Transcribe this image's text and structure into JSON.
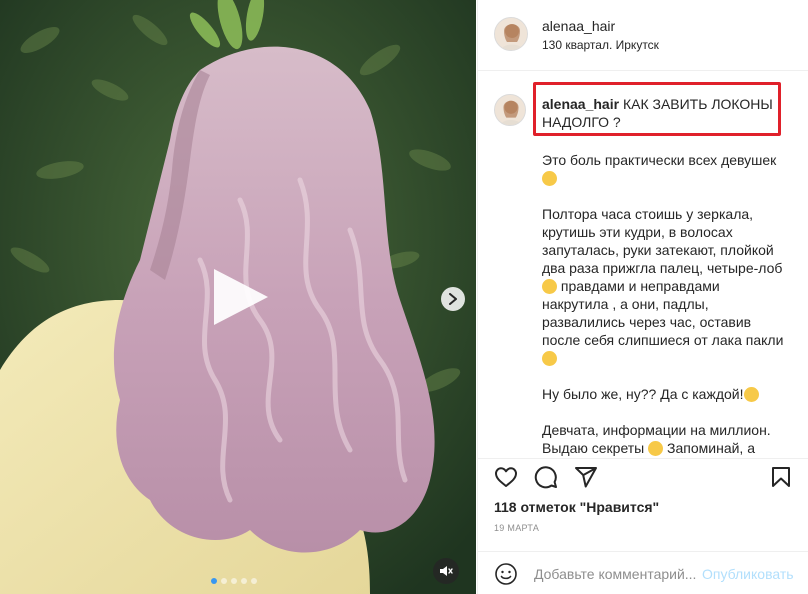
{
  "post": {
    "username": "alenaa_hair",
    "location": "130 квартал. Иркутск",
    "caption_title": "КАК ЗАВИТЬ ЛОКОНЫ НАДОЛГО ?",
    "caption_lines": [
      "Это боль практически всех девушек",
      "",
      "Полтора часа стоишь у зеркала,",
      "крутишь эти кудри, в волосах",
      "запуталась, руки затекают, плойкой",
      "два раза прижгла палец, четыре-лоб",
      "правдами и неправдами",
      "накрутила , а они, падлы,",
      "развалились через час, оставив",
      "после себя слипшиеся от лака пакли",
      "",
      "Ну было же, ну?? Да с каждой!",
      "",
      "Девчата, информации на миллион.",
      "Выдаю секреты  Запоминай, а"
    ],
    "likes": "118 отметок \"Нравится\"",
    "date": "19 МАРТА",
    "comment_placeholder": "Добавьте комментарий...",
    "publish_label": "Опубликовать"
  },
  "media": {
    "carousel_count": 5,
    "active_index": 0
  },
  "icons": {
    "like": "heart-icon",
    "comment": "comment-icon",
    "share": "share-icon",
    "save": "bookmark-icon",
    "emoji": "smiley-icon",
    "play": "play-icon",
    "next": "chevron-right-icon",
    "mute": "speaker-muted-icon"
  },
  "colors": {
    "highlight": "#e0202a",
    "accent": "#3897f0",
    "publish_disabled": "#b2dffc"
  }
}
